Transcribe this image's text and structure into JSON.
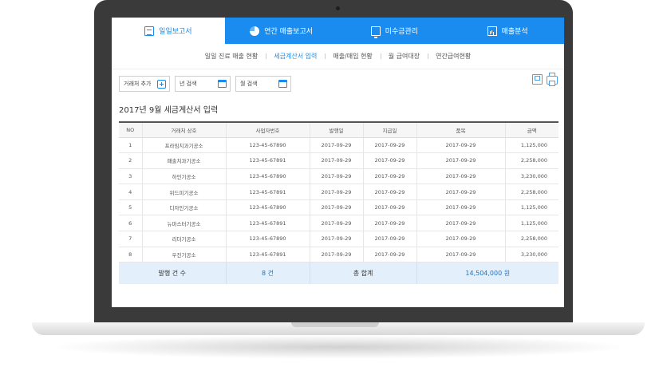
{
  "top_tabs": [
    {
      "label": "일일보고서",
      "icon": "clipboard-icon",
      "active": true
    },
    {
      "label": "연간 매출보고서",
      "icon": "pie-chart-icon",
      "active": false
    },
    {
      "label": "미수금관리",
      "icon": "monitor-icon",
      "active": false
    },
    {
      "label": "매출분석",
      "icon": "presentation-chart-icon",
      "active": false
    }
  ],
  "sub_nav": [
    {
      "label": "일일 진료 매출 현황",
      "active": false
    },
    {
      "label": "세금계산서 입력",
      "active": true
    },
    {
      "label": "매출/매입 현황",
      "active": false
    },
    {
      "label": "월 급여대장",
      "active": false
    },
    {
      "label": "연간급여현황",
      "active": false
    }
  ],
  "toolbar": {
    "add_vendor_label": "거래처 추가",
    "year_search_label": "년 검색",
    "month_search_label": "월 검색"
  },
  "page_title": "2017년 9월 세금계산서 입력",
  "table": {
    "headers": [
      "NO",
      "거래처 상호",
      "사업자번호",
      "발행일",
      "지급일",
      "품목",
      "금액"
    ],
    "rows": [
      [
        "1",
        "프라임치과기공소",
        "123-45-67890",
        "2017-09-29",
        "2017-09-29",
        "2017-09-29",
        "1,125,000"
      ],
      [
        "2",
        "패출치과기공소",
        "123-45-67891",
        "2017-09-29",
        "2017-09-29",
        "2017-09-29",
        "2,258,000"
      ],
      [
        "3",
        "하인기공소",
        "123-45-67890",
        "2017-09-29",
        "2017-09-29",
        "2017-09-29",
        "3,230,000"
      ],
      [
        "4",
        "위드피기공소",
        "123-45-67891",
        "2017-09-29",
        "2017-09-29",
        "2017-09-29",
        "2,258,000"
      ],
      [
        "5",
        "디자인기공소",
        "123-45-67890",
        "2017-09-29",
        "2017-09-29",
        "2017-09-29",
        "1,125,000"
      ],
      [
        "6",
        "뉴마스터기공소",
        "123-45-67891",
        "2017-09-29",
        "2017-09-29",
        "2017-09-29",
        "1,125,000"
      ],
      [
        "7",
        "리더기공소",
        "123-45-67890",
        "2017-09-29",
        "2017-09-29",
        "2017-09-29",
        "2,258,000"
      ],
      [
        "8",
        "우진기공소",
        "123-45-67891",
        "2017-09-29",
        "2017-09-29",
        "2017-09-29",
        "3,230,000"
      ]
    ],
    "footer": {
      "issue_count_label": "발행 건 수",
      "issue_count_value": "8 건",
      "total_label": "총 합계",
      "total_value": "14,504,000 원"
    }
  },
  "colors": {
    "accent": "#1a8cf0",
    "footer_bg": "#e3f0fb"
  }
}
